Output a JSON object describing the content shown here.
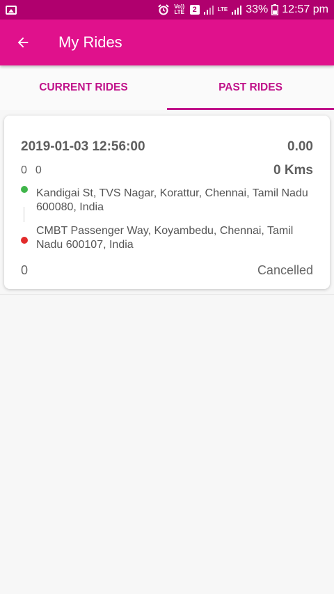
{
  "status_bar": {
    "image_icon": "image-icon",
    "alarm_icon": "alarm-icon",
    "volte_label": "Vo)) LTE",
    "sim_label": "2",
    "lte_label": "LTE",
    "battery_percent": "33%",
    "time": "12:57 pm"
  },
  "app_bar": {
    "title": "My Rides",
    "back_icon": "arrow-left-icon",
    "color": "#e0118c"
  },
  "tabs": [
    {
      "label": "CURRENT RIDES",
      "selected": false
    },
    {
      "label": "PAST RIDES",
      "selected": true
    }
  ],
  "rides": [
    {
      "datetime": "2019-01-03 12:56:00",
      "fare": "0.00",
      "count_a": "0",
      "count_b": "0",
      "distance": "0 Kms",
      "pickup": "Kandigai St, TVS Nagar, Korattur, Chennai, Tamil Nadu 600080, India",
      "drop": "CMBT Passenger Way, Koyambedu, Chennai, Tamil Nadu 600107, India",
      "amount": "0",
      "status": "Cancelled"
    }
  ],
  "colors": {
    "accent": "#c0138a",
    "pickup_dot": "#3fb54a",
    "drop_dot": "#e22b2b"
  }
}
